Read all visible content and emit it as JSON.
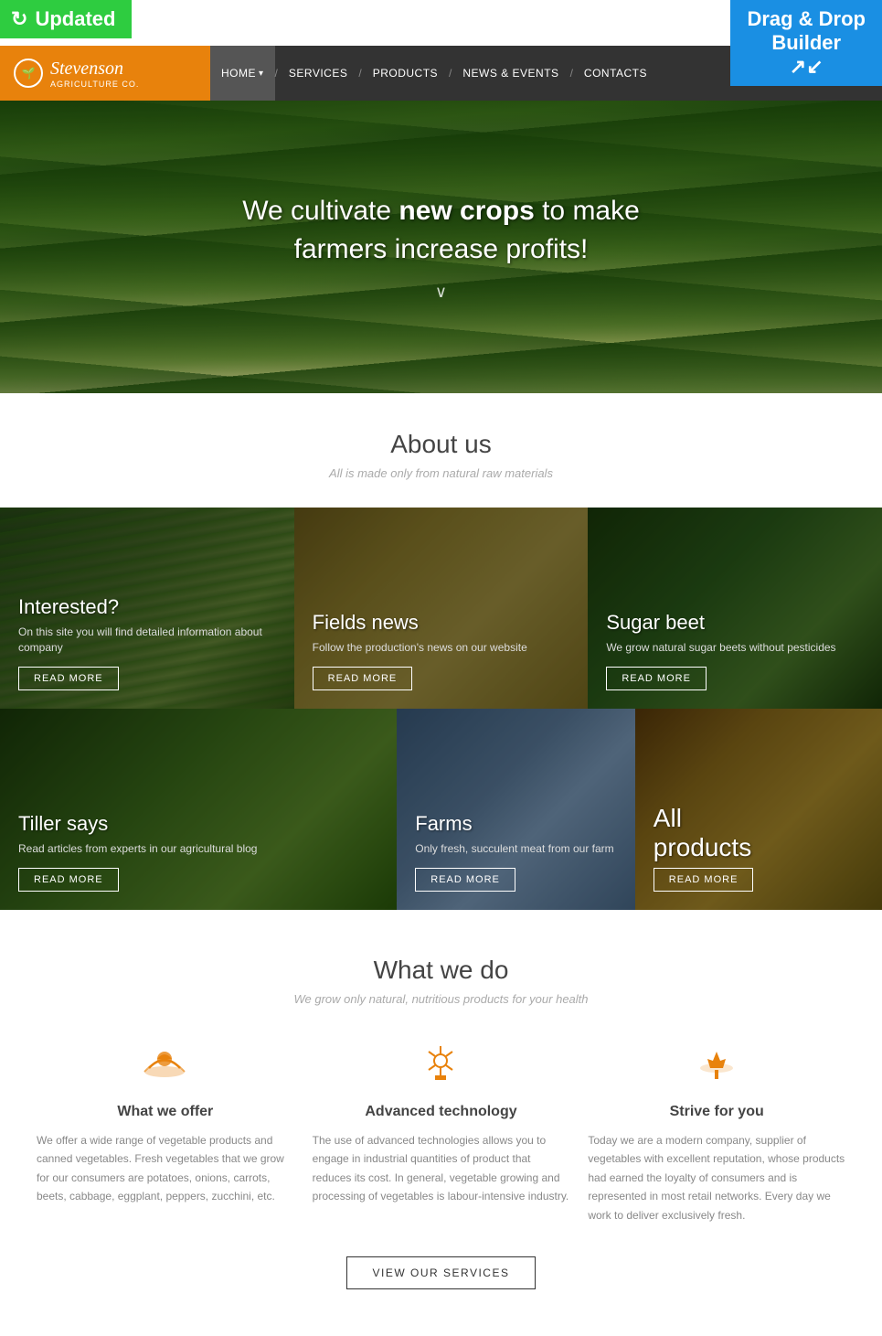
{
  "badges": {
    "updated": "Updated",
    "drag": "Drag & Drop\nBuilder"
  },
  "header": {
    "logo_name": "Stevenson",
    "logo_sub": "AGRICULTURE CO.",
    "nav_items": [
      {
        "label": "HOME",
        "active": true
      },
      {
        "label": "SERVICES",
        "active": false
      },
      {
        "label": "PRODUCTS",
        "active": false
      },
      {
        "label": "NEWS & EVENTS",
        "active": false
      },
      {
        "label": "CONTACTS",
        "active": false
      }
    ]
  },
  "hero": {
    "title_part1": "We cultivate ",
    "title_bold": "new crops",
    "title_part2": " to make\nfarmers increase profits!"
  },
  "about": {
    "title": "About us",
    "subtitle": "All is made only from natural raw materials"
  },
  "cards": [
    {
      "id": "interested",
      "title": "Interested?",
      "desc": "On this site you will find detailed information about company",
      "btn": "READ MORE"
    },
    {
      "id": "fields-news",
      "title": "Fields news",
      "desc": "Follow the production's news on our website",
      "btn": "READ MORE"
    },
    {
      "id": "sugar-beet",
      "title": "Sugar beet",
      "desc": "We grow natural sugar beets without pesticides",
      "btn": "READ MORE"
    },
    {
      "id": "tiller",
      "title": "Tiller says",
      "desc": "Read articles from experts in our agricultural blog",
      "btn": "READ MORE"
    },
    {
      "id": "farms",
      "title": "Farms",
      "desc": "Only fresh, succulent meat from our farm",
      "btn": "READ MORE"
    },
    {
      "id": "all-products",
      "title": "All\nproducts",
      "btn": "READ MORE"
    }
  ],
  "what": {
    "title": "What we do",
    "subtitle": "We grow only natural, nutritious products for your health",
    "features": [
      {
        "icon": "🌾",
        "title": "What we offer",
        "desc": "We offer a wide range of vegetable products and canned vegetables. Fresh vegetables that we grow for our consumers are potatoes, onions, carrots, beets, cabbage, eggplant, peppers, zucchini, etc."
      },
      {
        "icon": "⚙️",
        "title": "Advanced technology",
        "desc": "The use of advanced technologies allows you to engage in industrial quantities of product that reduces its cost. In general, vegetable growing and processing of vegetables is labour-intensive industry."
      },
      {
        "icon": "🌿",
        "title": "Strive for you",
        "desc": "Today we are a modern company, supplier of vegetables with excellent reputation, whose products had earned the loyalty of consumers and is represented in most retail networks. Every day we work to deliver exclusively fresh."
      }
    ],
    "view_btn": "VIEW OUR SERVICES"
  }
}
